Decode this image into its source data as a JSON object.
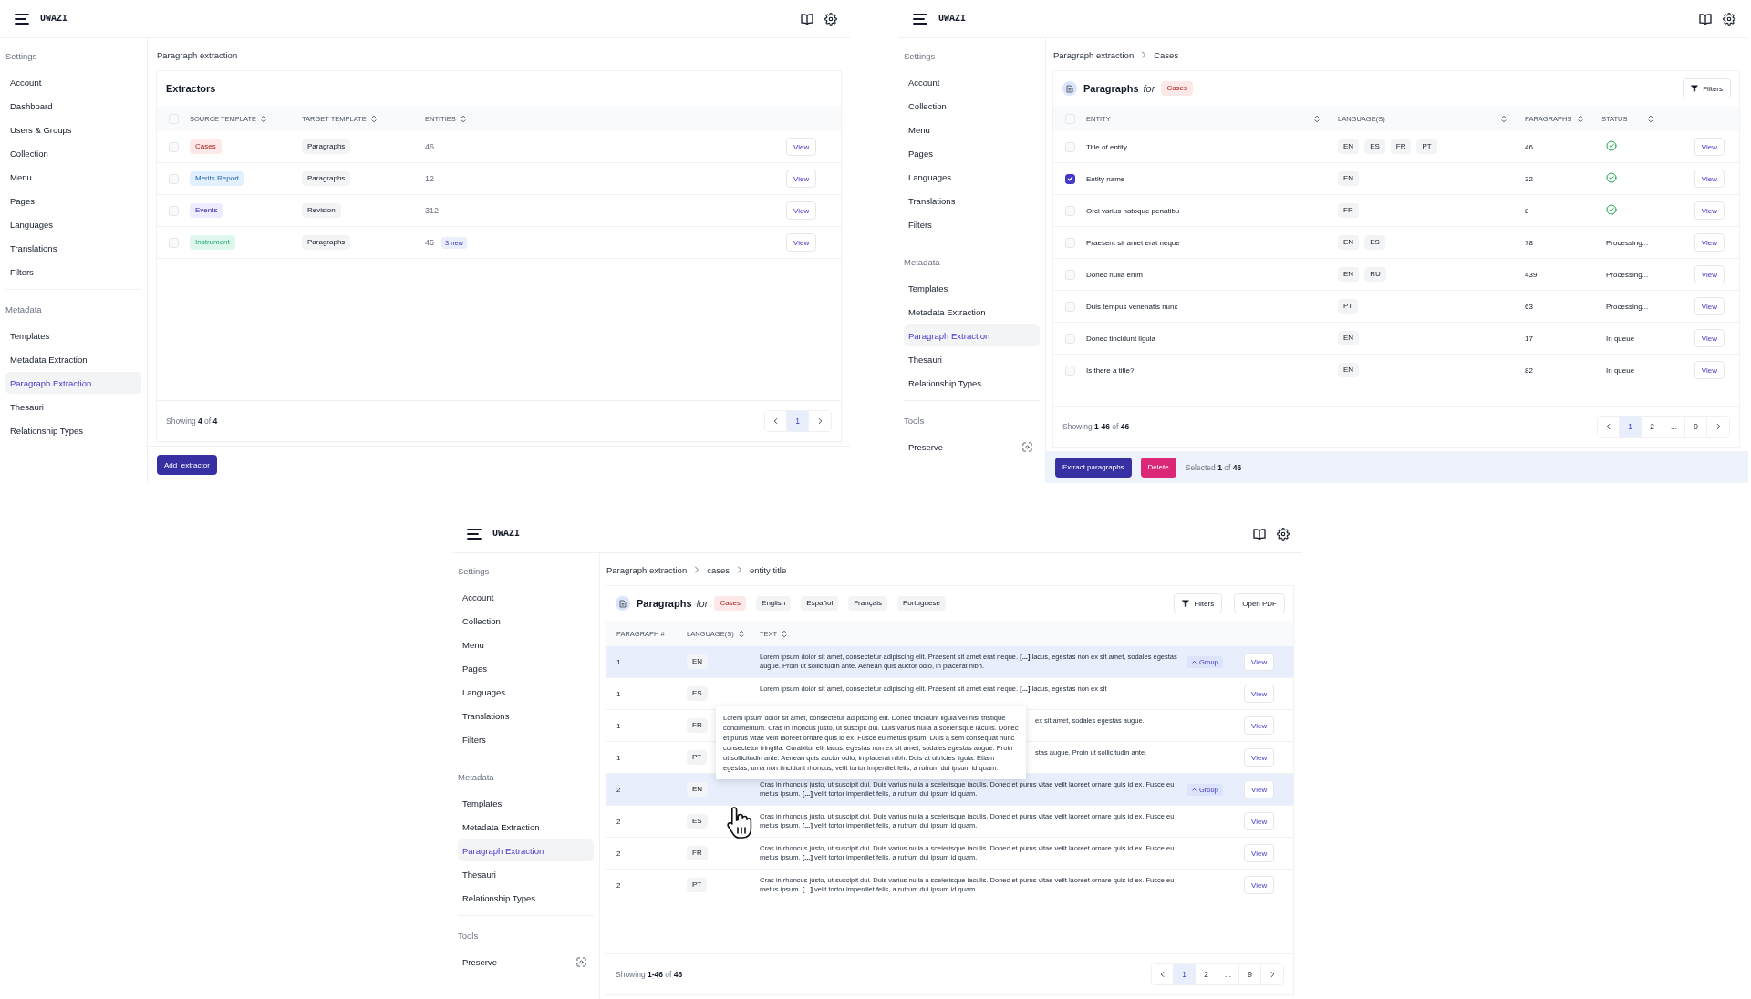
{
  "extractors_screen": {
    "app_bar": {
      "title": "UWAZI"
    },
    "sidebar": {
      "sections": [
        {
          "title": "Settings",
          "kind": "links",
          "items": [
            {
              "label": "Account",
              "selected": false
            },
            {
              "label": "Dashboard",
              "selected": false
            },
            {
              "label": "Users & Groups",
              "selected": false
            },
            {
              "label": "Collection",
              "selected": false
            },
            {
              "label": "Menu",
              "selected": false
            },
            {
              "label": "Pages",
              "selected": false
            },
            {
              "label": "Languages",
              "selected": false
            },
            {
              "label": "Translations",
              "selected": false
            },
            {
              "label": "Filters",
              "selected": false
            }
          ]
        },
        {
          "title": "Metadata",
          "kind": "links",
          "items": [
            {
              "label": "Templates",
              "selected": false
            },
            {
              "label": "Metadata Extraction",
              "selected": false
            },
            {
              "label": "Paragraph Extraction",
              "selected": true
            },
            {
              "label": "Thesauri",
              "selected": false
            },
            {
              "label": "Relationship Types",
              "selected": false
            }
          ]
        }
      ]
    },
    "breadcrumb": [
      "Paragraph extraction"
    ],
    "title": "Extractors",
    "table": {
      "all_checked": false,
      "columns": [
        {
          "label": "SOURCE TEMPLATE",
          "sortable": true
        },
        {
          "label": "TARGET TEMPLATE",
          "sortable": true
        },
        {
          "label": "ENTITIES",
          "sortable": true
        }
      ],
      "rows": [
        {
          "checked": false,
          "source": {
            "label": "Cases",
            "color": "#fde8e8"
          },
          "target": "Paragraphs",
          "entities": "46",
          "action": "View"
        },
        {
          "checked": false,
          "source": {
            "label": "Merits Report",
            "color": "#e1effe"
          },
          "target": "Paragraphs",
          "entities": "12",
          "action": "View"
        },
        {
          "checked": false,
          "source": {
            "label": "Events",
            "color": "#edebfe"
          },
          "target": "Revision",
          "entities": "312",
          "action": "View"
        },
        {
          "checked": false,
          "source": {
            "label": "Instrument",
            "color": "#def7ec"
          },
          "target": "Paragraphs",
          "entities": "45",
          "badge": "3 new",
          "action": "View"
        }
      ]
    },
    "footer": {
      "showing": "Showing **4** of **4**",
      "pages": [
        {
          "label": "1",
          "selected": true
        }
      ]
    },
    "primary_button": "Add  extractor"
  },
  "cases_screen": {
    "app_bar": {
      "title": "UWAZI"
    },
    "sidebar": {
      "sections": [
        {
          "title": "Settings",
          "kind": "links",
          "items": [
            {
              "label": "Account",
              "selected": false
            },
            {
              "label": "Collection",
              "selected": false
            },
            {
              "label": "Menu",
              "selected": false
            },
            {
              "label": "Pages",
              "selected": false
            },
            {
              "label": "Languages",
              "selected": false
            },
            {
              "label": "Translations",
              "selected": false
            },
            {
              "label": "Filters",
              "selected": false
            }
          ]
        },
        {
          "title": "Metadata",
          "kind": "links",
          "items": [
            {
              "label": "Templates",
              "selected": false
            },
            {
              "label": "Metadata Extraction",
              "selected": false
            },
            {
              "label": "Paragraph Extraction",
              "selected": true
            },
            {
              "label": "Thesauri",
              "selected": false
            },
            {
              "label": "Relationship Types",
              "selected": false
            }
          ]
        },
        {
          "title": "Tools",
          "kind": "tools",
          "items": [
            {
              "label": "Preserve",
              "selected": false
            }
          ]
        }
      ]
    },
    "breadcrumb": [
      "Paragraph extraction",
      "Cases"
    ],
    "title": "Paragraphs",
    "title_joiner": "for",
    "template_tag": {
      "label": "Cases",
      "color": "#fde8e8"
    },
    "filters_button": "Filters",
    "table": {
      "all_checked": false,
      "columns": [
        {
          "label": "ENTITY",
          "sortable": true
        },
        {
          "label": "LANGUAGE(S)",
          "sortable": true
        },
        {
          "label": "PARAGRAPHS",
          "sortable": true
        },
        {
          "label": "STATUS",
          "sortable": true
        }
      ],
      "rows": [
        {
          "checked": false,
          "entity": "Title of entity",
          "languages": [
            "EN",
            "ES",
            "FR",
            "PT"
          ],
          "paragraphs": "46",
          "status": {
            "kind": "done"
          },
          "action": "View"
        },
        {
          "checked": true,
          "entity": "Entity name",
          "languages": [
            "EN"
          ],
          "paragraphs": "32",
          "status": {
            "kind": "done"
          },
          "action": "View"
        },
        {
          "checked": false,
          "entity": "Orci varius natoque penatibu",
          "languages": [
            "FR"
          ],
          "paragraphs": "8",
          "status": {
            "kind": "done"
          },
          "action": "View"
        },
        {
          "checked": false,
          "entity": "Praesent sit amet erat neque",
          "languages": [
            "EN",
            "ES"
          ],
          "paragraphs": "78",
          "status": {
            "kind": "text",
            "text": "Processing..."
          },
          "action": "View"
        },
        {
          "checked": false,
          "entity": "Donec nulla enim",
          "languages": [
            "EN",
            "RU"
          ],
          "paragraphs": "439",
          "status": {
            "kind": "text",
            "text": "Processing..."
          },
          "action": "View"
        },
        {
          "checked": false,
          "entity": "Duis tempus venenatis nunc",
          "languages": [
            "PT"
          ],
          "paragraphs": "63",
          "status": {
            "kind": "text",
            "text": "Processing..."
          },
          "action": "View"
        },
        {
          "checked": false,
          "entity": "Donec tincidunt ligula",
          "languages": [
            "EN"
          ],
          "paragraphs": "17",
          "status": {
            "kind": "text",
            "text": "In queue"
          },
          "action": "View"
        },
        {
          "checked": false,
          "entity": "Is there a title?",
          "languages": [
            "EN"
          ],
          "paragraphs": "82",
          "status": {
            "kind": "text",
            "text": "In queue"
          },
          "action": "View"
        }
      ]
    },
    "footer": {
      "showing": "Showing **1-46** of **46**",
      "pages": [
        {
          "label": "1",
          "selected": true
        },
        {
          "label": "2",
          "selected": false
        },
        {
          "label": "...",
          "selected": false
        },
        {
          "label": "9",
          "selected": false
        }
      ]
    },
    "action_bar": {
      "primary_button": "Extract paragraphs",
      "danger_button": "Delete",
      "selection": "Selected **1** of **46**"
    }
  },
  "entity_screen": {
    "app_bar": {
      "title": "UWAZI"
    },
    "sidebar": {
      "sections": [
        {
          "title": "Settings",
          "kind": "links",
          "items": [
            {
              "label": "Account",
              "selected": false
            },
            {
              "label": "Collection",
              "selected": false
            },
            {
              "label": "Menu",
              "selected": false
            },
            {
              "label": "Pages",
              "selected": false
            },
            {
              "label": "Languages",
              "selected": false
            },
            {
              "label": "Translations",
              "selected": false
            },
            {
              "label": "Filters",
              "selected": false
            }
          ]
        },
        {
          "title": "Metadata",
          "kind": "links",
          "items": [
            {
              "label": "Templates",
              "selected": false
            },
            {
              "label": "Metadata Extraction",
              "selected": false
            },
            {
              "label": "Paragraph Extraction",
              "selected": true
            },
            {
              "label": "Thesauri",
              "selected": false
            },
            {
              "label": "Relationship Types",
              "selected": false
            }
          ]
        },
        {
          "title": "Tools",
          "kind": "tools",
          "items": [
            {
              "label": "Preserve",
              "selected": false
            }
          ]
        }
      ]
    },
    "breadcrumb": [
      "Paragraph extraction",
      "cases",
      "entity title"
    ],
    "title": "Paragraphs",
    "title_joiner": "for",
    "template_tag": {
      "label": "Cases",
      "color": "#fde8e8"
    },
    "language_chips": [
      "English",
      "Español",
      "Français",
      "Portuguese"
    ],
    "filters_button": "Filters",
    "open_pdf_button": "Open PDF",
    "table": {
      "columns": [
        {
          "label": "PARAGRAPH #",
          "sortable": false
        },
        {
          "label": "LANGUAGE(S)",
          "sortable": true
        },
        {
          "label": "TEXT",
          "sortable": true
        }
      ],
      "rows": [
        {
          "paragraph": "1",
          "language": "EN",
          "kind": "full",
          "selected": true,
          "group": "Group",
          "text": "Lorem ipsum dolor sit amet, consectetur adipiscing elit. Praesent sit amet erat neque. **[...]** lacus, egestas non ex sit amet, sodales egestas augue. Proin ut sollicitudin ante. Aenean quis auctor odio, in placerat nibh.",
          "action": "View"
        },
        {
          "paragraph": "1",
          "language": "ES",
          "kind": "first_line",
          "selected": false,
          "text": "Lorem ipsum dolor sit amet, consectetur adipiscing elit. Praesent sit amet erat neque. **[...]** lacus, egestas non ex sit",
          "action": "View"
        },
        {
          "paragraph": "1",
          "language": "FR",
          "kind": "tail",
          "selected": false,
          "text": "ex sit amet, sodales egestas augue.",
          "action": "View"
        },
        {
          "paragraph": "1",
          "language": "PT",
          "kind": "tail",
          "selected": false,
          "text": "stas augue. Proin ut sollicitudin ante.",
          "action": "View"
        },
        {
          "paragraph": "2",
          "language": "EN",
          "kind": "full",
          "selected": true,
          "group": "Group",
          "text": "Cras in rhoncus justo, ut suscipit dui. Duis varius nulla a scelerisque iaculis. Donec et purus vitae velit laoreet ornare quis id ex. Fusce eu metus ipsum. **[...]** velit tortor imperdiet felis, a rutrum dui ipsum id quam.",
          "action": "View"
        },
        {
          "paragraph": "2",
          "language": "ES",
          "kind": "full",
          "selected": false,
          "text": "Cras in rhoncus justo, ut suscipit dui. Duis varius nulla a scelerisque iaculis. Donec et purus vitae velit laoreet ornare quis id ex. Fusce eu metus ipsum. **[...]** velit tortor imperdiet felis, a rutrum dui ipsum id quam.",
          "action": "View"
        },
        {
          "paragraph": "2",
          "language": "FR",
          "kind": "full",
          "selected": false,
          "text": "Cras in rhoncus justo, ut suscipit dui. Duis varius nulla a scelerisque iaculis. Donec et purus vitae velit laoreet ornare quis id ex. Fusce eu metus ipsum. **[...]** velit tortor imperdiet felis, a rutrum dui ipsum id quam.",
          "action": "View"
        },
        {
          "paragraph": "2",
          "language": "PT",
          "kind": "full",
          "selected": false,
          "text": "Cras in rhoncus justo, ut suscipit dui. Duis varius nulla a scelerisque iaculis. Donec et purus vitae velit laoreet ornare quis id ex. Fusce eu metus ipsum. **[...]** velit tortor imperdiet felis, a rutrum dui ipsum id quam.",
          "action": "View"
        }
      ]
    },
    "tooltip": "Lorem ipsum dolor sit amet, consectetur adipiscing elit. Donec tincidunt ligula vel nisi tristique condimentum. Cras in rhoncus justo, ut suscipit dui. Duis varius nulla a scelerisque iaculis. Donec et purus vitae velit laoreet ornare quis id ex. Fusce eu metus ipsum. Duis a sem consequat nunc consectetur fringilla. Curabitur elit lacus, egestas non ex sit amet, sodales egestas augue. Proin ut sollicitudin ante. Aenean quis auctor odio, in placerat nibh. Duis at ultricies ligula. Etiam egestas, urna non tincidunt rhoncus, velit tortor imperdiet felis, a rutrum dui ipsum id quam.",
    "footer": {
      "showing": "Showing **1-46** of **46**",
      "pages": [
        {
          "label": "1",
          "selected": true
        },
        {
          "label": "2",
          "selected": false
        },
        {
          "label": "...",
          "selected": false
        },
        {
          "label": "9",
          "selected": false
        }
      ]
    }
  }
}
